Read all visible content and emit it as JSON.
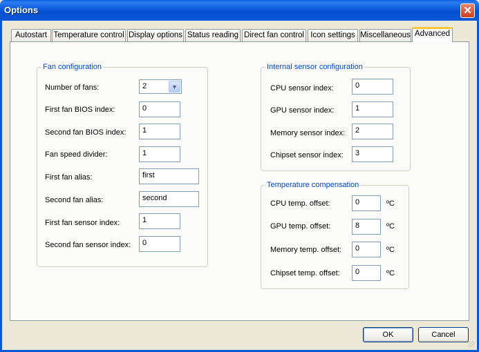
{
  "window": {
    "title": "Options",
    "close_glyph": "✕"
  },
  "tabs": [
    {
      "label": "Autostart"
    },
    {
      "label": "Temperature control"
    },
    {
      "label": "Display options"
    },
    {
      "label": "Status reading"
    },
    {
      "label": "Direct fan control"
    },
    {
      "label": "Icon settings"
    },
    {
      "label": "Miscellaneous"
    },
    {
      "label": "Advanced",
      "active": true
    }
  ],
  "fan_configuration": {
    "legend": "Fan configuration",
    "number_of_fans_label": "Number of fans:",
    "number_of_fans_value": "2",
    "first_bios_label": "First fan BIOS index:",
    "first_bios_value": "0",
    "second_bios_label": "Second fan BIOS index:",
    "second_bios_value": "1",
    "divider_label": "Fan speed divider:",
    "divider_value": "1",
    "first_alias_label": "First fan alias:",
    "first_alias_value": "first",
    "second_alias_label": "Second fan alias:",
    "second_alias_value": "second",
    "first_sensor_label": "First fan sensor index:",
    "first_sensor_value": "1",
    "second_sensor_label": "Second fan sensor index:",
    "second_sensor_value": "0"
  },
  "internal_sensor": {
    "legend": "Internal sensor configuration",
    "cpu_label": "CPU sensor index:",
    "cpu_value": "0",
    "gpu_label": "GPU sensor index:",
    "gpu_value": "1",
    "memory_label": "Memory sensor index:",
    "memory_value": "2",
    "chipset_label": "Chipset sensor index:",
    "chipset_value": "3"
  },
  "temperature_compensation": {
    "legend": "Temperature compensation",
    "unit": "ºC",
    "cpu_label": "CPU temp. offset:",
    "cpu_value": "0",
    "gpu_label": "GPU temp. offset:",
    "gpu_value": "8",
    "memory_label": "Memory temp. offset:",
    "memory_value": "0",
    "chipset_label": "Chipset temp. offset:",
    "chipset_value": "0"
  },
  "buttons": {
    "ok": "OK",
    "cancel": "Cancel"
  },
  "icons": {
    "close": "close-icon",
    "dropdown": "chevron-down-icon"
  },
  "colors": {
    "titlebar": "#0a58d6",
    "legend": "#0046d5",
    "active_tab_highlight": "#ffc83c",
    "close_button": "#c9401e"
  }
}
